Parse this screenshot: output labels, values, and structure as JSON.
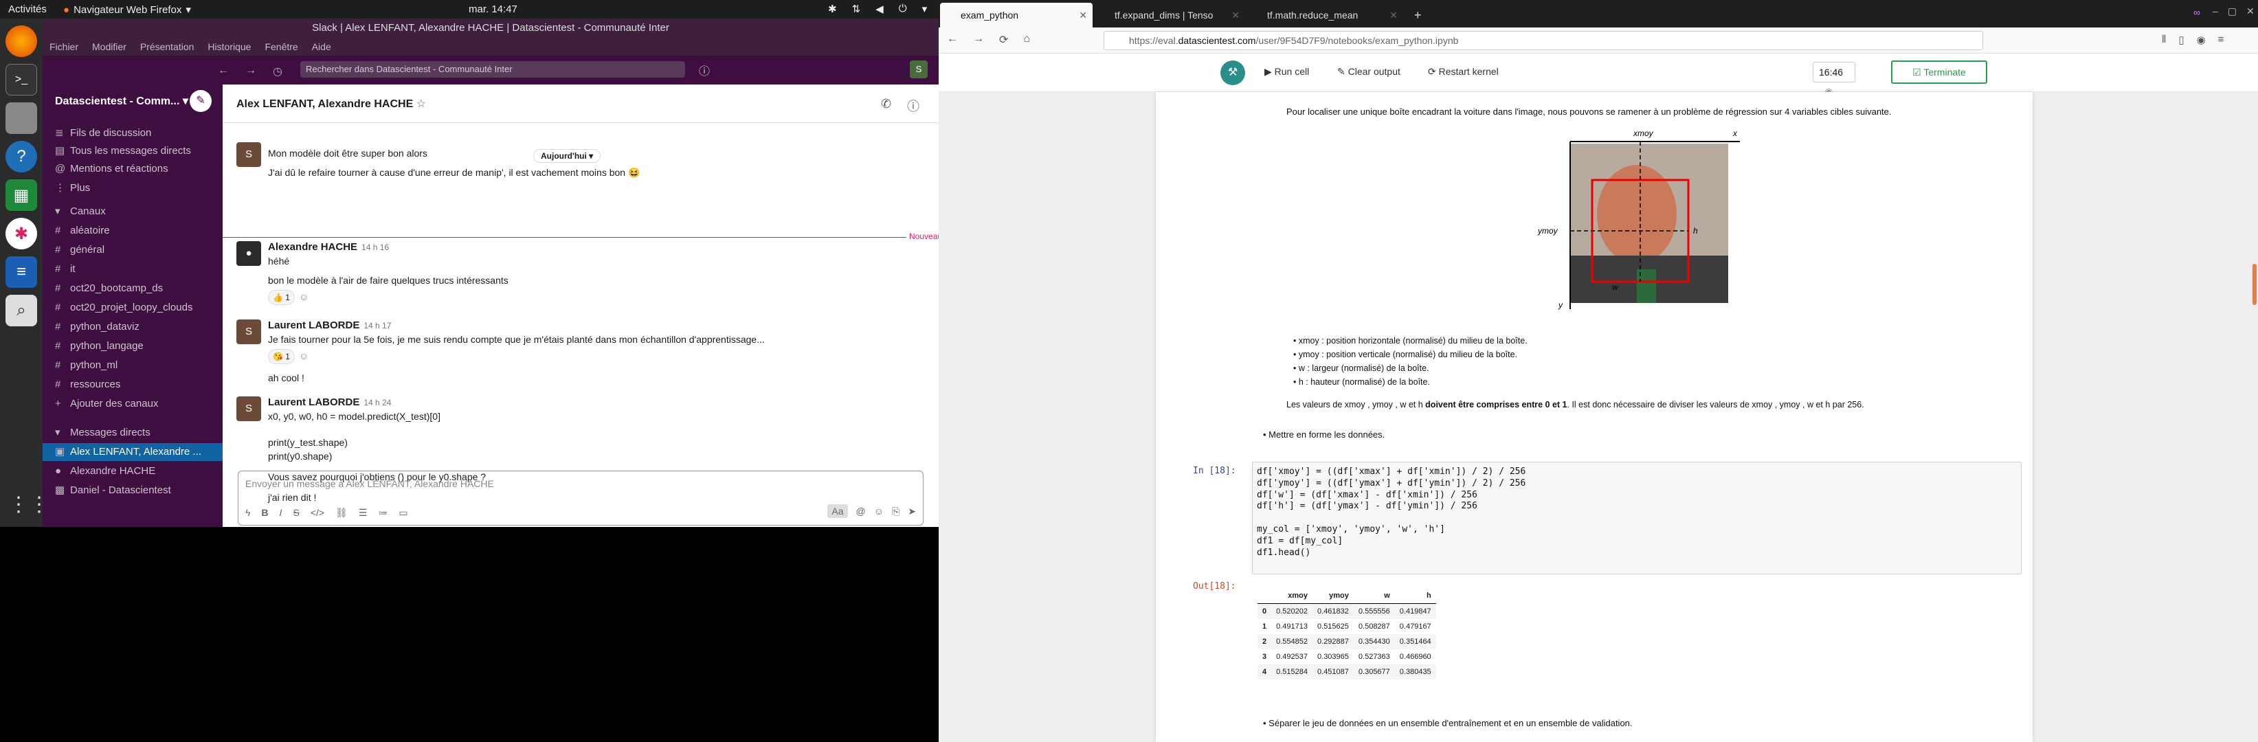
{
  "topbar": {
    "activities": "Activités",
    "app": "Navigateur Web Firefox",
    "clock": "mar. 14:47"
  },
  "slack": {
    "window_title": "Slack | Alex LENFANT, Alexandre HACHE | Datascientest - Communauté Inter",
    "menu": [
      "Fichier",
      "Modifier",
      "Présentation",
      "Historique",
      "Fenêtre",
      "Aide"
    ],
    "search_placeholder": "Rechercher dans Datascientest - Communauté Inter",
    "user_initial": "S",
    "sidebar": {
      "workspace": "Datascientest - Comm...",
      "top_items": [
        "Fils de discussion",
        "Tous les messages directs",
        "Mentions et réactions",
        "Plus"
      ],
      "channels_header": "Canaux",
      "channels": [
        "aléatoire",
        "général",
        "it",
        "oct20_bootcamp_ds",
        "oct20_projet_loopy_clouds",
        "python_dataviz",
        "python_langage",
        "python_ml",
        "ressources"
      ],
      "add_channels": "Ajouter des canaux",
      "dm_header": "Messages directs",
      "dms": [
        "Alex LENFANT, Alexandre ...",
        "Alexandre HACHE",
        "Daniel - Datascientest"
      ],
      "dm_group_count": "2"
    },
    "chat": {
      "title": "Alex LENFANT, Alexandre HACHE",
      "today_label": "Aujourd'hui",
      "new_label": "Nouveau",
      "prev_lines": [
        "Mon modèle doit être super bon alors",
        "J'ai dû le refaire tourner à cause d'une erreur de manip', il est vachement moins bon 😆"
      ],
      "messages": [
        {
          "author": "Alexandre HACHE",
          "time": "14 h 16",
          "lines": [
            "héhé",
            "bon le modèle à l'air de faire quelques trucs intéressants"
          ],
          "reaction": "👍 1"
        },
        {
          "author": "Laurent LABORDE",
          "time": "14 h 17",
          "lines": [
            "Je fais tourner pour la 5e fois, je me suis rendu compte que je m'étais planté dans mon échantillon d'apprentissage...",
            "ah cool !"
          ],
          "reaction": "😘 1"
        },
        {
          "author": "Laurent LABORDE",
          "time": "14 h 24",
          "lines": [
            "x0, y0, w0, h0 = model.predict(X_test)[0]",
            "print(y_test.shape)",
            "print(y0.shape)",
            "Vous savez pourquoi j'obtiens () pour le y0.shape ?",
            "j'ai rien dit !"
          ]
        }
      ],
      "composer_placeholder": "Envoyer un message à Alex LENFANT, Alexandre HACHE",
      "composer_aa": "Aa"
    }
  },
  "firefox": {
    "tabs": [
      "exam_python",
      "tf.expand_dims | Tenso",
      "tf.math.reduce_mean"
    ],
    "url_host": "https://eval.",
    "url_domain": "datascientest.com",
    "url_path": "/user/9F54D7F9/notebooks/exam_python.ipynb",
    "toolbar": {
      "run": "Run cell",
      "clear": "Clear output",
      "restart": "Restart kernel",
      "timer": "16:46",
      "terminate": "Terminate"
    }
  },
  "notebook": {
    "intro": "Pour localiser une unique boîte encadrant la voiture dans l'image, nous pouvons se ramener à un problème de régression sur 4 variables cibles suivante.",
    "fig_labels": {
      "xmoy": "xmoy",
      "ymoy": "ymoy",
      "x": "x",
      "y": "y",
      "h": "h",
      "w": "w"
    },
    "bullets": [
      "xmoy : position horizontale (normalisé) du milieu de la boîte.",
      "ymoy : position verticale (normalisé) du milieu de la boîte.",
      "w : largeur (normalisé) de la boîte.",
      "h : hauteur (normalisé) de la boîte."
    ],
    "range_note_start": "Les valeurs de xmoy , ymoy , w et h ",
    "range_note_bold": "doivent être comprises entre 0 et 1",
    "range_note_end": ". Il est donc nécessaire de diviser les valeurs de xmoy , ymoy , w et h par 256.",
    "step1": "Mettre en forme les données.",
    "in_prompt": "In [18]:",
    "code": "df['xmoy'] = ((df['xmax'] + df['xmin']) / 2) / 256\ndf['ymoy'] = ((df['ymax'] + df['ymin']) / 2) / 256\ndf['w'] = (df['xmax'] - df['xmin']) / 256\ndf['h'] = (df['ymax'] - df['ymin']) / 256\n\nmy_col = ['xmoy', 'ymoy', 'w', 'h']\ndf1 = df[my_col]\ndf1.head()",
    "out_prompt": "Out[18]:",
    "table": {
      "columns": [
        "",
        "xmoy",
        "ymoy",
        "w",
        "h"
      ],
      "rows": [
        [
          "0",
          "0.520202",
          "0.461832",
          "0.555556",
          "0.419847"
        ],
        [
          "1",
          "0.491713",
          "0.515625",
          "0.508287",
          "0.479167"
        ],
        [
          "2",
          "0.554852",
          "0.292887",
          "0.354430",
          "0.351464"
        ],
        [
          "3",
          "0.492537",
          "0.303965",
          "0.527363",
          "0.466960"
        ],
        [
          "4",
          "0.515284",
          "0.451087",
          "0.305677",
          "0.380435"
        ]
      ]
    },
    "step2": "Séparer le jeu de données en un ensemble d'entraînement et en un ensemble de validation."
  }
}
